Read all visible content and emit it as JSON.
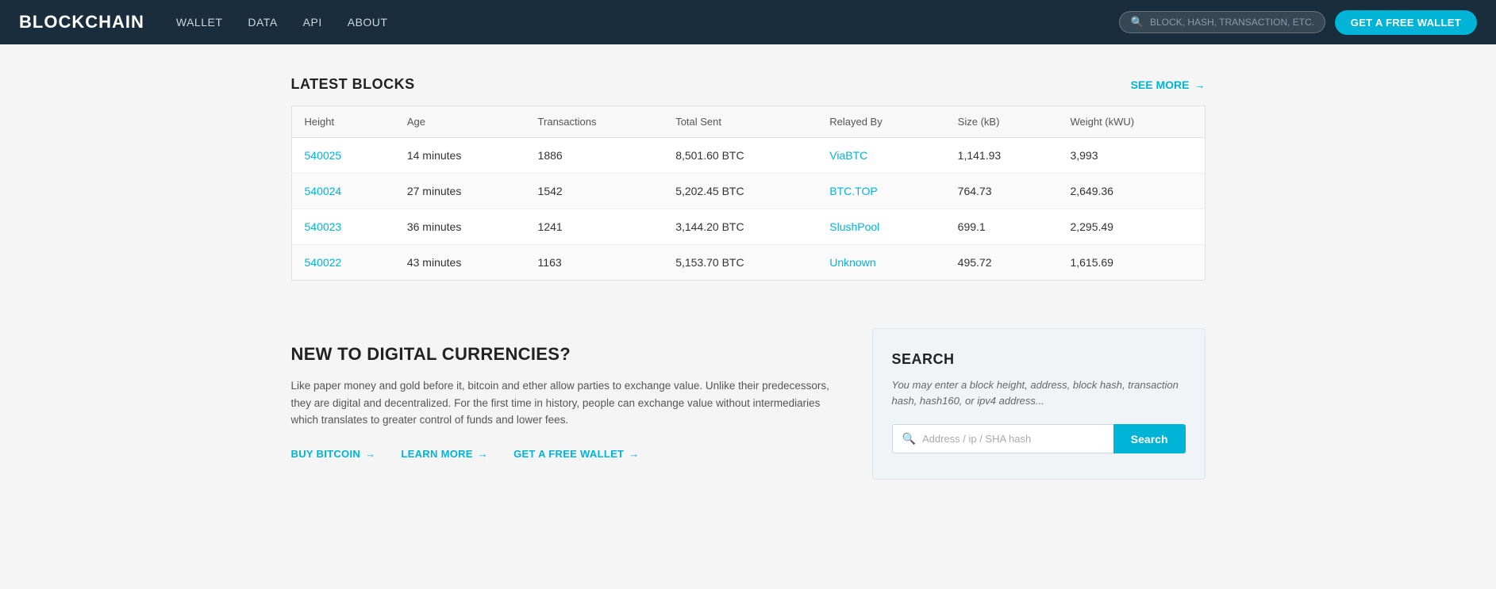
{
  "nav": {
    "logo": "BLOCKCHAIN",
    "links": [
      "WALLET",
      "DATA",
      "API",
      "ABOUT"
    ],
    "search_placeholder": "BLOCK, HASH, TRANSACTION, ETC...",
    "wallet_btn": "GET A FREE WALLET"
  },
  "latest_blocks": {
    "title": "LATEST BLOCKS",
    "see_more": "SEE MORE",
    "columns": [
      "Height",
      "Age",
      "Transactions",
      "Total Sent",
      "Relayed By",
      "Size (kB)",
      "Weight (kWU)"
    ],
    "rows": [
      {
        "height": "540025",
        "age": "14 minutes",
        "transactions": "1886",
        "total_sent": "8,501.60 BTC",
        "relayed_by": "ViaBTC",
        "size": "1,141.93",
        "weight": "3,993"
      },
      {
        "height": "540024",
        "age": "27 minutes",
        "transactions": "1542",
        "total_sent": "5,202.45 BTC",
        "relayed_by": "BTC.TOP",
        "size": "764.73",
        "weight": "2,649.36"
      },
      {
        "height": "540023",
        "age": "36 minutes",
        "transactions": "1241",
        "total_sent": "3,144.20 BTC",
        "relayed_by": "SlushPool",
        "size": "699.1",
        "weight": "2,295.49"
      },
      {
        "height": "540022",
        "age": "43 minutes",
        "transactions": "1163",
        "total_sent": "5,153.70 BTC",
        "relayed_by": "Unknown",
        "size": "495.72",
        "weight": "1,615.69"
      }
    ]
  },
  "new_to_crypto": {
    "title": "NEW TO DIGITAL CURRENCIES?",
    "text": "Like paper money and gold before it, bitcoin and ether allow parties to exchange value. Unlike their predecessors, they are digital and decentralized. For the first time in history, people can exchange value without intermediaries which translates to greater control of funds and lower fees.",
    "links": [
      {
        "label": "BUY BITCOIN",
        "arrow": "→"
      },
      {
        "label": "LEARN MORE",
        "arrow": "→"
      },
      {
        "label": "GET A FREE WALLET",
        "arrow": "→"
      }
    ]
  },
  "search_section": {
    "title": "SEARCH",
    "description": "You may enter a block height, address, block hash, transaction hash, hash160, or ipv4 address...",
    "input_placeholder": "Address / ip / SHA hash",
    "button_label": "Search"
  }
}
